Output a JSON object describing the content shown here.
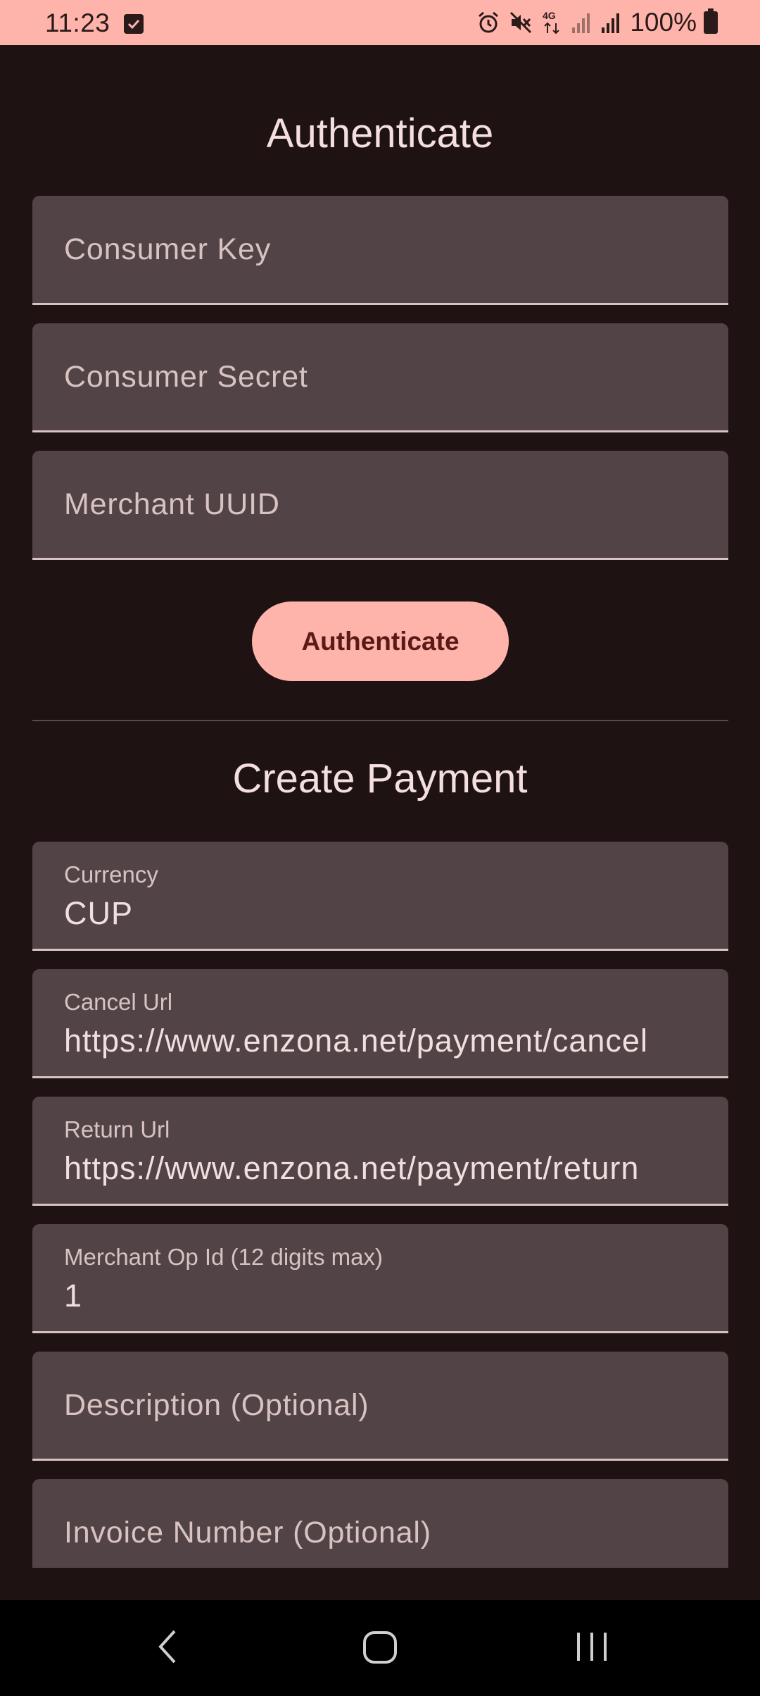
{
  "status_bar": {
    "time": "11:23",
    "battery": "100%",
    "icons": [
      "checkbox-icon",
      "alarm-icon",
      "mute-icon",
      "4g-icon",
      "signal-icon",
      "signal-icon",
      "battery-icon"
    ]
  },
  "authenticate": {
    "title": "Authenticate",
    "fields": [
      {
        "placeholder": "Consumer Key"
      },
      {
        "placeholder": "Consumer Secret"
      },
      {
        "placeholder": "Merchant UUID"
      }
    ],
    "button_label": "Authenticate"
  },
  "payment": {
    "title": "Create Payment",
    "fields": [
      {
        "label": "Currency",
        "value": "CUP"
      },
      {
        "label": "Cancel Url",
        "value": "https://www.enzona.net/payment/cancel"
      },
      {
        "label": "Return Url",
        "value": "https://www.enzona.net/payment/return"
      },
      {
        "label": "Merchant Op Id (12 digits max)",
        "value": "1"
      },
      {
        "placeholder": "Description (Optional)"
      },
      {
        "placeholder": "Invoice Number (Optional)"
      }
    ]
  },
  "colors": {
    "background": "#1e1212",
    "accent": "#ffb4ab",
    "field_bg": "#524446",
    "button_text": "#5a1a18"
  }
}
